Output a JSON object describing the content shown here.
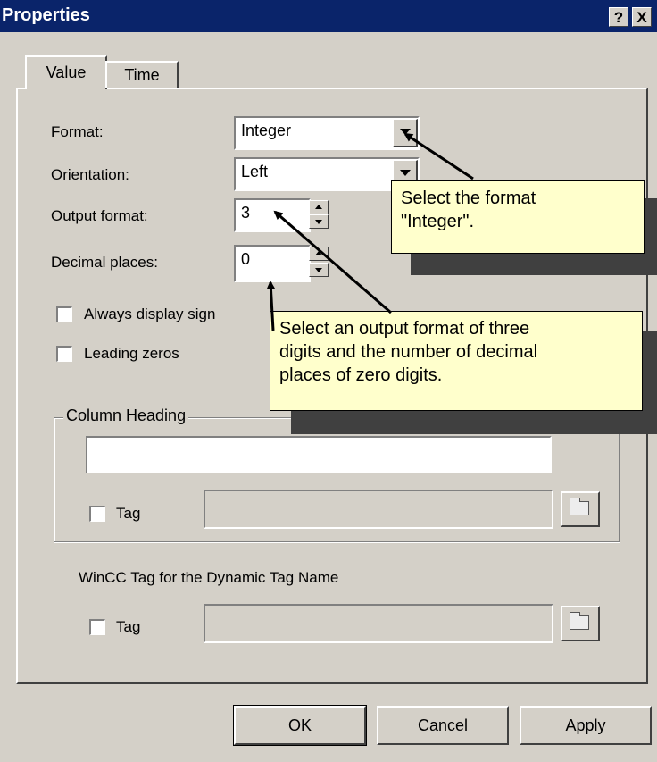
{
  "window": {
    "title": "Properties",
    "help_glyph": "?",
    "close_glyph": "X"
  },
  "tabs": [
    {
      "label": "Value",
      "active": true
    },
    {
      "label": "Time",
      "active": false
    }
  ],
  "format": {
    "label": "Format:",
    "value": "Integer"
  },
  "orientation": {
    "label": "Orientation:",
    "value": "Left"
  },
  "output_format": {
    "label": "Output format:",
    "value": "3"
  },
  "decimal_places": {
    "label": "Decimal places:",
    "value": "0"
  },
  "checkboxes": [
    {
      "label": "Always display sign",
      "checked": false
    },
    {
      "label": "Leading zeros",
      "checked": false
    }
  ],
  "column_heading": {
    "legend": "Column Heading",
    "value": "",
    "tag_label": "Tag",
    "tag_checked": false,
    "tag_value": ""
  },
  "wincc": {
    "label": "WinCC Tag for the Dynamic Tag Name",
    "tag_label": "Tag",
    "tag_checked": false,
    "tag_value": ""
  },
  "buttons": {
    "ok": "OK",
    "cancel": "Cancel",
    "apply": "Apply"
  },
  "callouts": {
    "format_note": [
      "Select the format",
      "\"Integer\"."
    ],
    "output_note": [
      "Select an output format of three",
      "digits and the number of decimal",
      "places of zero digits."
    ]
  },
  "colors": {
    "title_bar": "#0a246a",
    "dialog_bg": "#d4d0c8",
    "callout_bg": "#ffffcc",
    "callout_shadow": "#404040"
  },
  "icons": {
    "browse": "folder-icon"
  }
}
